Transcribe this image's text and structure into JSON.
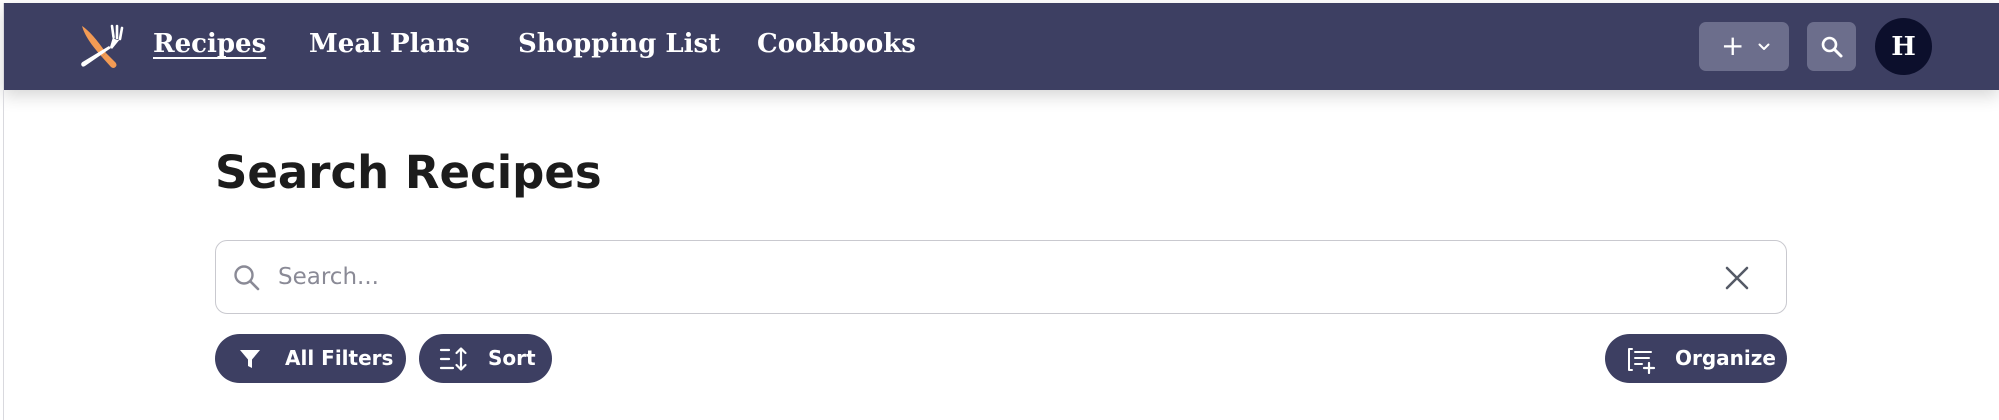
{
  "nav": {
    "logo_icon": "fork-knife-logo-icon",
    "links": [
      {
        "label": "Recipes",
        "active": true
      },
      {
        "label": "Meal Plans",
        "active": false
      },
      {
        "label": "Shopping List",
        "active": false
      },
      {
        "label": "Cookbooks",
        "active": false
      }
    ],
    "add_button": {
      "label": "+",
      "icon": "chevron-down-icon"
    },
    "search_button": {
      "icon": "search-icon"
    },
    "avatar": {
      "initial": "H"
    }
  },
  "page": {
    "title": "Search Recipes",
    "search": {
      "placeholder": "Search...",
      "value": "",
      "clear_icon": "close-icon"
    },
    "toolbar": {
      "filters_label": "All Filters",
      "sort_label": "Sort",
      "organize_label": "Organize"
    }
  },
  "colors": {
    "navbar": "#3d3f62",
    "nav_button": "#6c6e8c",
    "avatar": "#0c0f2c",
    "logo_accent": "#f39b54",
    "pill": "#3d3f62"
  }
}
